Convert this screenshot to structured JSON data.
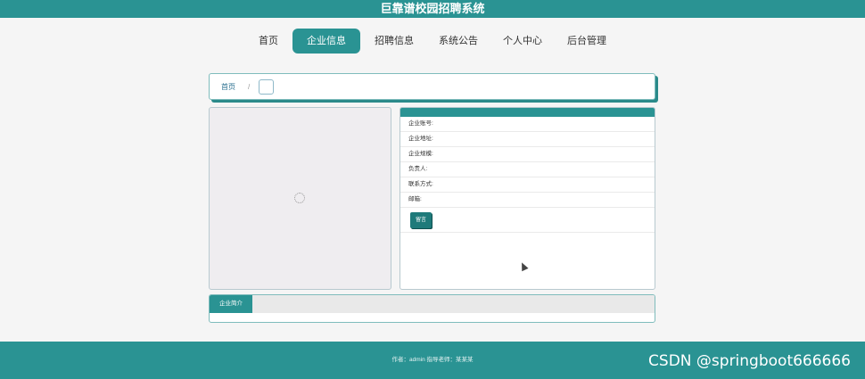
{
  "app": {
    "title": "巨靠谱校园招聘系统"
  },
  "nav": {
    "items": [
      {
        "label": "首页",
        "active": false
      },
      {
        "label": "企业信息",
        "active": true
      },
      {
        "label": "招聘信息",
        "active": false
      },
      {
        "label": "系统公告",
        "active": false
      },
      {
        "label": "个人中心",
        "active": false
      },
      {
        "label": "后台管理",
        "active": false
      }
    ]
  },
  "breadcrumb": {
    "home": "首页",
    "separator": "/"
  },
  "details": {
    "fields": [
      {
        "label": "企业账号:"
      },
      {
        "label": "企业地址:"
      },
      {
        "label": "企业规模:"
      },
      {
        "label": "负责人:"
      },
      {
        "label": "联系方式:"
      },
      {
        "label": "邮箱:"
      }
    ],
    "collect_label": "留言"
  },
  "intro": {
    "tab_label": "企业简介"
  },
  "footer": {
    "text": "作者：admin 指导老师：某某某",
    "watermark": "CSDN @springboot666666"
  }
}
